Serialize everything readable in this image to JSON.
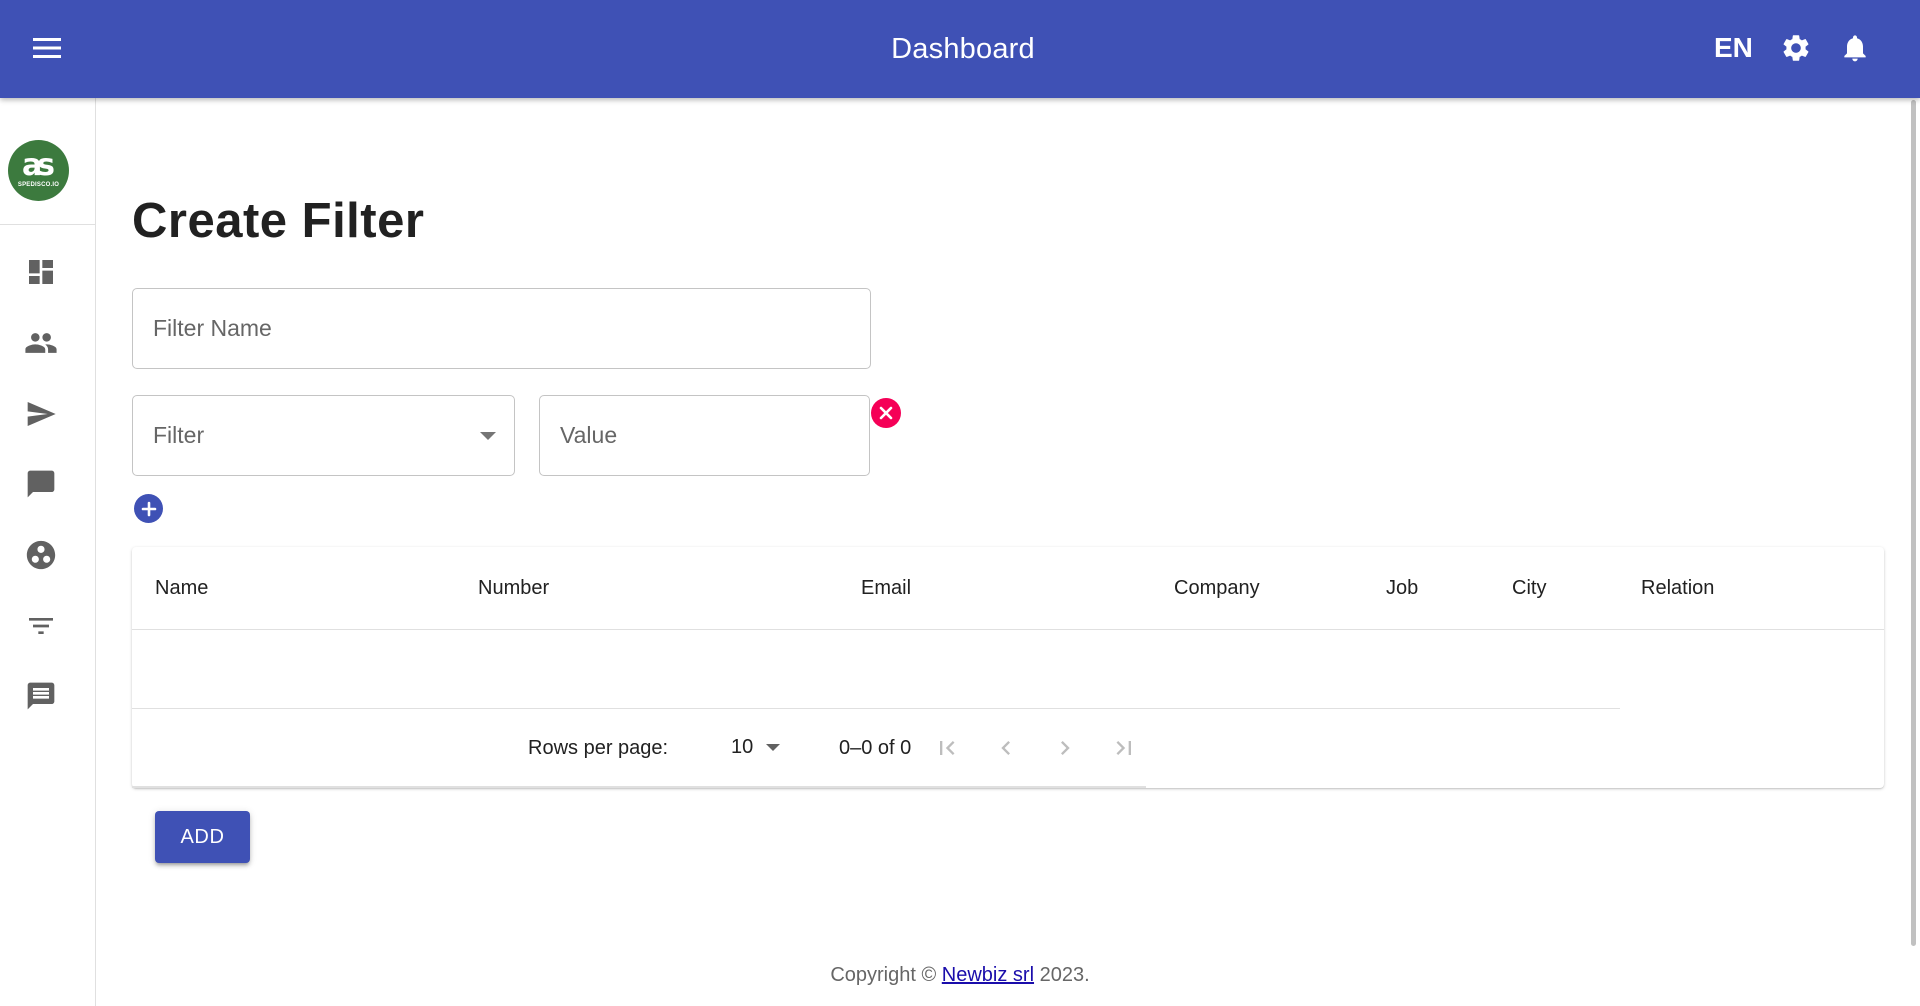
{
  "appbar": {
    "title": "Dashboard",
    "language": "EN",
    "icons": [
      "menu-icon",
      "settings-icon",
      "notifications-icon"
    ]
  },
  "sidebar": {
    "logo_text": "SPEDISCO.IO",
    "items": [
      {
        "icon": "dashboard-icon"
      },
      {
        "icon": "people-icon"
      },
      {
        "icon": "send-icon"
      },
      {
        "icon": "chat-bubble-icon"
      },
      {
        "icon": "group-work-icon"
      },
      {
        "icon": "filter-list-icon"
      },
      {
        "icon": "message-icon"
      }
    ]
  },
  "main": {
    "title": "Create Filter",
    "filter_name_placeholder": "Filter Name",
    "filter_select_label": "Filter",
    "value_placeholder": "Value"
  },
  "table": {
    "columns": [
      "Name",
      "Number",
      "Email",
      "Company",
      "Job",
      "City",
      "Relation"
    ],
    "rows": [],
    "pagination": {
      "rows_per_page_label": "Rows per page:",
      "rows_per_page_value": "10",
      "range": "0–0 of 0"
    }
  },
  "actions": {
    "add_label": "ADD"
  },
  "footer": {
    "prefix": "Copyright ©",
    "link_text": "Newbiz srl",
    "suffix": "2023."
  },
  "colors": {
    "primary": "#3f51b5",
    "danger": "#f50057",
    "logo_green": "#3c7a3e"
  }
}
